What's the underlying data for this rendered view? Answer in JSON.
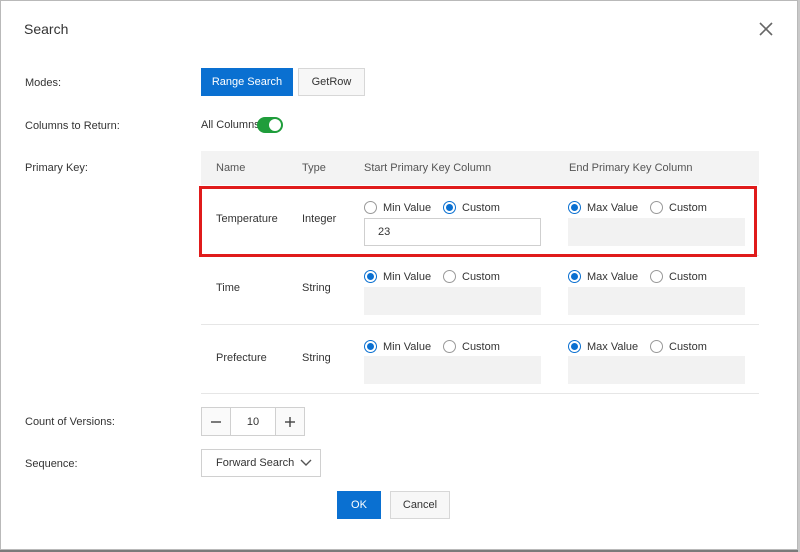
{
  "dialog": {
    "title": "Search"
  },
  "modes": {
    "label": "Modes:",
    "options": [
      {
        "label": "Range Search",
        "active": true
      },
      {
        "label": "GetRow",
        "active": false
      }
    ]
  },
  "columns_to_return": {
    "label": "Columns to Return:",
    "toggle_text": "All Columns",
    "enabled": true
  },
  "primary_key": {
    "label": "Primary Key:",
    "headers": {
      "name": "Name",
      "type": "Type",
      "start": "Start Primary Key Column",
      "end": "End Primary Key Column"
    },
    "rows": [
      {
        "name": "Temperature",
        "type": "Integer",
        "start_min_label": "Min Value",
        "start_custom_label": "Custom",
        "start_selected": "Custom",
        "start_value": "23",
        "end_max_label": "Max Value",
        "end_custom_label": "Custom",
        "end_selected": "Max Value",
        "end_value": ""
      },
      {
        "name": "Time",
        "type": "String",
        "start_min_label": "Min Value",
        "start_custom_label": "Custom",
        "start_selected": "Min Value",
        "start_value": "",
        "end_max_label": "Max Value",
        "end_custom_label": "Custom",
        "end_selected": "Max Value",
        "end_value": ""
      },
      {
        "name": "Prefecture",
        "type": "String",
        "start_min_label": "Min Value",
        "start_custom_label": "Custom",
        "start_selected": "Min Value",
        "start_value": "",
        "end_max_label": "Max Value",
        "end_custom_label": "Custom",
        "end_selected": "Max Value",
        "end_value": ""
      }
    ]
  },
  "versions": {
    "label": "Count of Versions:",
    "value": "10"
  },
  "sequence": {
    "label": "Sequence:",
    "selected": "Forward Search"
  },
  "footer": {
    "ok_label": "OK",
    "cancel_label": "Cancel"
  },
  "colors": {
    "accent": "#0a70d1",
    "toggle_on": "#1f9d3b",
    "highlight": "#e01b1b"
  },
  "icons": [
    "close-icon",
    "minus-icon",
    "plus-icon",
    "chevron-down-icon"
  ]
}
